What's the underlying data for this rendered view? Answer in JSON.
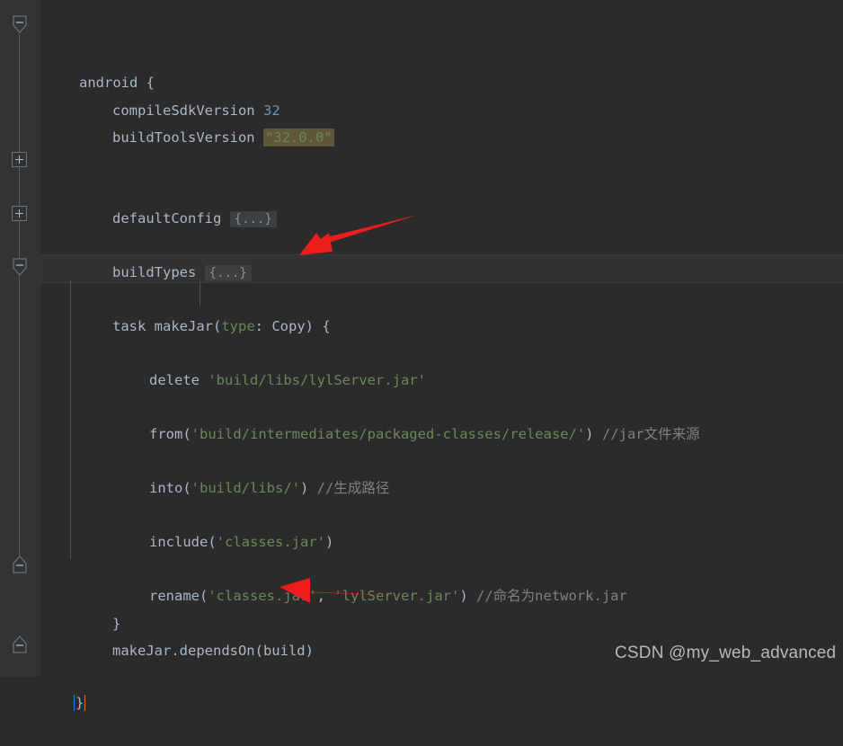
{
  "editor": {
    "background_color": "#2b2b2b",
    "gutter_color": "#313335",
    "current_line_color": "#323232",
    "search_highlight_color": "#60563a",
    "fold_placeholder": "{...}",
    "arrow_color": "#ee1c1c"
  },
  "code": {
    "line1": {
      "indent": "",
      "name": "android",
      "brace": " {"
    },
    "line2": {
      "key": "compileSdkVersion",
      "value": "32"
    },
    "line3": {
      "key": "buildToolsVersion",
      "value": "\"32.0.0\""
    },
    "line4": {
      "key": "defaultConfig",
      "fold": "{...}"
    },
    "line5": {
      "key": "buildTypes",
      "fold": "{...}"
    },
    "line6": {
      "kw": "task",
      "name": " makeJar",
      "paren_open": "(",
      "label": "type",
      "colon": ": ",
      "type": "Copy",
      "paren_close": ")",
      "brace": " {"
    },
    "line7": {
      "fn": "delete",
      "space": " ",
      "arg": "'build/libs/lylServer.jar'"
    },
    "line8": {
      "fn": "from",
      "paren_open": "(",
      "arg": "'build/intermediates/packaged-classes/release/'",
      "paren_close": ")",
      "comment": " //jar文件来源"
    },
    "line9": {
      "fn": "into",
      "paren_open": "(",
      "arg": "'build/libs/'",
      "paren_close": ")",
      "comment": " //生成路径"
    },
    "line10": {
      "fn": "include",
      "paren_open": "(",
      "arg": "'classes.jar'",
      "paren_close": ")"
    },
    "line11": {
      "fn": "rename",
      "paren_open": "(",
      "arg1": "'classes.jar'",
      "sep": ", ",
      "arg2": "'lylServer.jar'",
      "paren_close": ")",
      "comment": " //命名为network.jar"
    },
    "line12": {
      "brace": "}"
    },
    "line13": {
      "text": "makeJar.dependsOn(build)"
    },
    "line14": {
      "brace": "}"
    }
  },
  "gutter": {
    "marker_android": "fold-expanded-pentagon",
    "marker_defaultconfig": "fold-collapsed-plus",
    "marker_buildtypes": "fold-collapsed-plus",
    "marker_makejar_open": "fold-expanded-pentagon",
    "marker_makejar_close": "fold-expanded-end",
    "marker_android_close": "fold-expanded-end"
  },
  "annotations": {
    "arrow1_name": "red-arrow-pointing-to-task-makejar",
    "arrow2_name": "red-arrow-pointing-to-makejar-dependson"
  },
  "watermark": {
    "text": "CSDN @my_web_advanced"
  }
}
